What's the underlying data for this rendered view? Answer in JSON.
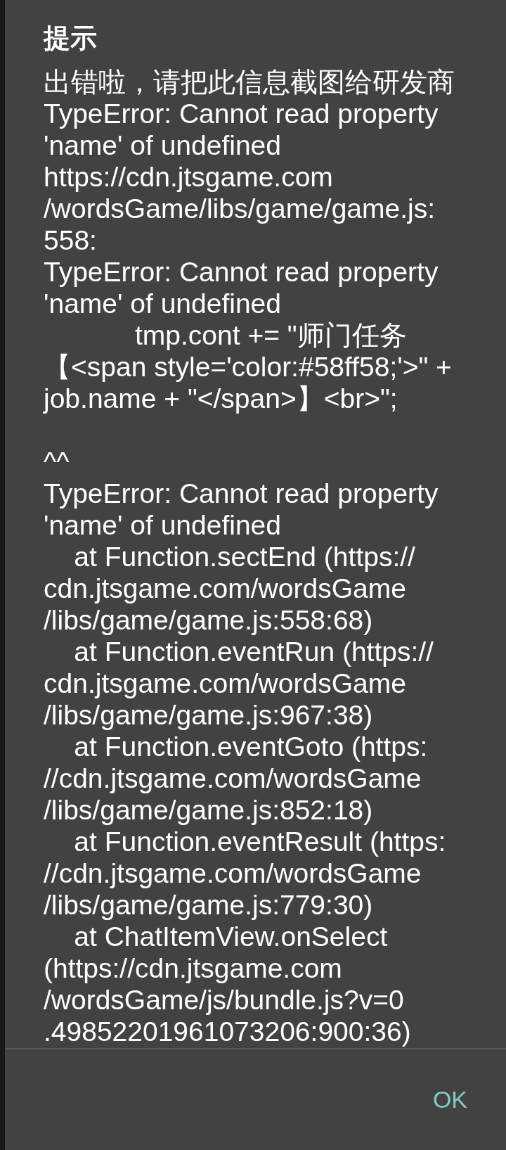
{
  "dialog": {
    "title": "提示",
    "message_blocks": [
      [
        "出错啦，请把此信息截图给研发商",
        "TypeError: Cannot read property",
        "'name' of undefined",
        "https://cdn.jtsgame.com",
        "/wordsGame/libs/game/game.js:",
        "558:",
        "TypeError: Cannot read property",
        "'name' of undefined",
        "            tmp.cont += \"师门任务",
        "【<span style='color:#58ff58;'>\" +",
        "job.name + \"</span>】<br>\";"
      ],
      [
        "^^",
        "TypeError: Cannot read property",
        "'name' of undefined",
        "    at Function.sectEnd (https://",
        "cdn.jtsgame.com/wordsGame",
        "/libs/game/game.js:558:68)",
        "    at Function.eventRun (https://",
        "cdn.jtsgame.com/wordsGame",
        "/libs/game/game.js:967:38)",
        "    at Function.eventGoto (https:",
        "//cdn.jtsgame.com/wordsGame",
        "/libs/game/game.js:852:18)",
        "    at Function.eventResult (https:",
        "//cdn.jtsgame.com/wordsGame",
        "/libs/game/game.js:779:30)",
        "    at ChatItemView.onSelect",
        "(https://cdn.jtsgame.com",
        "/wordsGame/js/bundle.js?v=0",
        ".49852201961073206:900:36)"
      ]
    ],
    "buttons": [
      "OK"
    ]
  }
}
